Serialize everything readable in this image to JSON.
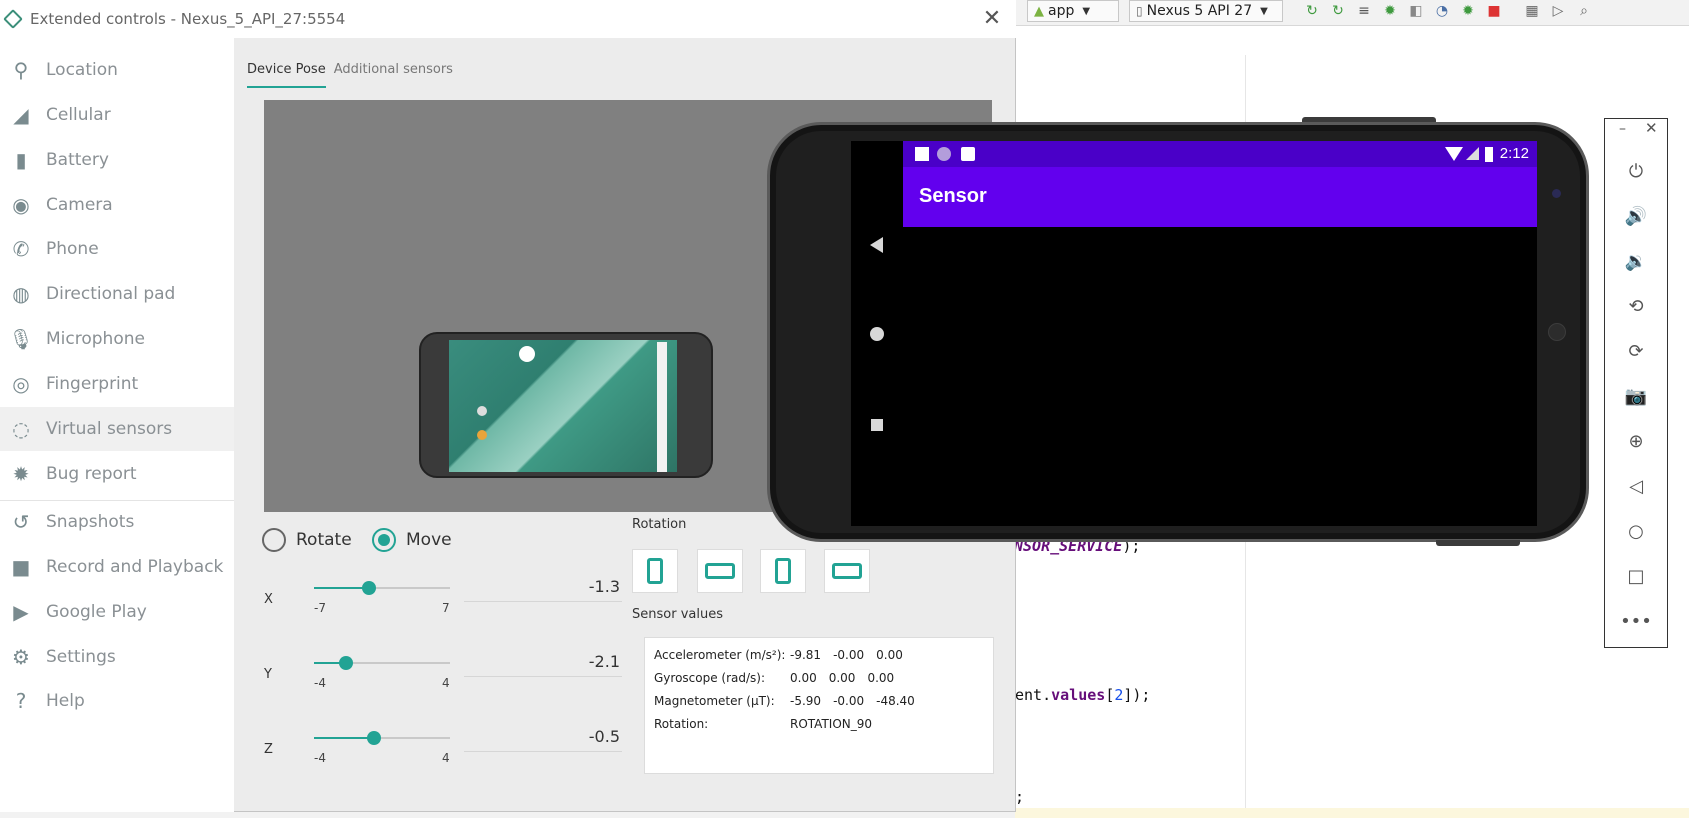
{
  "window": {
    "title": "Extended controls - Nexus_5_API_27:5554",
    "close_glyph": "✕"
  },
  "sidebar": {
    "items": [
      {
        "label": "Location",
        "icon": "location-pin-icon",
        "glyph": "⚲"
      },
      {
        "label": "Cellular",
        "icon": "signal-icon",
        "glyph": "◢"
      },
      {
        "label": "Battery",
        "icon": "battery-icon",
        "glyph": "▮"
      },
      {
        "label": "Camera",
        "icon": "camera-icon",
        "glyph": "◉"
      },
      {
        "label": "Phone",
        "icon": "phone-icon",
        "glyph": "✆"
      },
      {
        "label": "Directional pad",
        "icon": "dpad-icon",
        "glyph": "◍"
      },
      {
        "label": "Microphone",
        "icon": "microphone-icon",
        "glyph": "🎙"
      },
      {
        "label": "Fingerprint",
        "icon": "fingerprint-icon",
        "glyph": "◎"
      },
      {
        "label": "Virtual sensors",
        "icon": "sensors-icon",
        "glyph": "◌"
      },
      {
        "label": "Bug report",
        "icon": "bug-icon",
        "glyph": "✹"
      },
      {
        "label": "Snapshots",
        "icon": "history-icon",
        "glyph": "↺"
      },
      {
        "label": "Record and Playback",
        "icon": "video-camera-icon",
        "glyph": "■"
      },
      {
        "label": "Google Play",
        "icon": "play-store-icon",
        "glyph": "▶"
      },
      {
        "label": "Settings",
        "icon": "gear-icon",
        "glyph": "⚙"
      },
      {
        "label": "Help",
        "icon": "help-icon",
        "glyph": "?"
      }
    ],
    "active_index": 8
  },
  "tabs": [
    {
      "label": "Device Pose",
      "active": true
    },
    {
      "label": "Additional sensors",
      "active": false
    }
  ],
  "pose_mode": {
    "rotate_label": "Rotate",
    "move_label": "Move",
    "selected": "move"
  },
  "sliders": [
    {
      "axis": "X",
      "min_label": "-7",
      "max_label": "7",
      "min": -7,
      "max": 7,
      "value": -1.3,
      "value_text": "-1.3"
    },
    {
      "axis": "Y",
      "min_label": "-4",
      "max_label": "4",
      "min": -4,
      "max": 4,
      "value": -2.1,
      "value_text": "-2.1"
    },
    {
      "axis": "Z",
      "min_label": "-4",
      "max_label": "4",
      "min": -4,
      "max": 4,
      "value": -0.5,
      "value_text": "-0.5"
    }
  ],
  "rotation": {
    "title": "Rotation"
  },
  "sensor_values": {
    "title": "Sensor values",
    "rows": [
      {
        "name": "Accelerometer (m/s²):",
        "values": [
          "-9.81",
          "-0.00",
          "0.00"
        ]
      },
      {
        "name": "Gyroscope (rad/s):",
        "values": [
          "0.00",
          "0.00",
          "0.00"
        ]
      },
      {
        "name": "Magnetometer (μT):",
        "values": [
          "-5.90",
          "-0.00",
          "-48.40"
        ]
      },
      {
        "name": "Rotation:",
        "values": [
          "ROTATION_90"
        ]
      }
    ]
  },
  "ide": {
    "run_config": "app",
    "device": "Nexus 5 API 27",
    "code_line1_prefix": "NSOR_SERVICE",
    "code_line1_suffix": ");",
    "code_line2_prefix": "ent.",
    "code_line2_field": "values",
    "code_line2_index_open": "[",
    "code_line2_index": "2",
    "code_line2_suffix": "]);",
    "code_line3": ";"
  },
  "emulator": {
    "app_title": "Sensor",
    "time": "2:12",
    "colors": {
      "status_bar": "#4a00c8",
      "app_bar": "#6200ee",
      "accent": "#22a394"
    }
  },
  "emulator_toolbar": {
    "minimize_glyph": "–",
    "close_glyph": "✕",
    "buttons": [
      {
        "name": "power-icon",
        "glyph": "⏻"
      },
      {
        "name": "volume-up-icon",
        "glyph": "🔊"
      },
      {
        "name": "volume-down-icon",
        "glyph": "🔉"
      },
      {
        "name": "rotate-left-icon",
        "glyph": "⟲"
      },
      {
        "name": "rotate-right-icon",
        "glyph": "⟳"
      },
      {
        "name": "screenshot-icon",
        "glyph": "📷"
      },
      {
        "name": "zoom-icon",
        "glyph": "⊕"
      },
      {
        "name": "back-icon",
        "glyph": "◁"
      },
      {
        "name": "home-icon",
        "glyph": "○"
      },
      {
        "name": "overview-icon",
        "glyph": "□"
      },
      {
        "name": "more-icon",
        "glyph": "•••"
      }
    ]
  }
}
